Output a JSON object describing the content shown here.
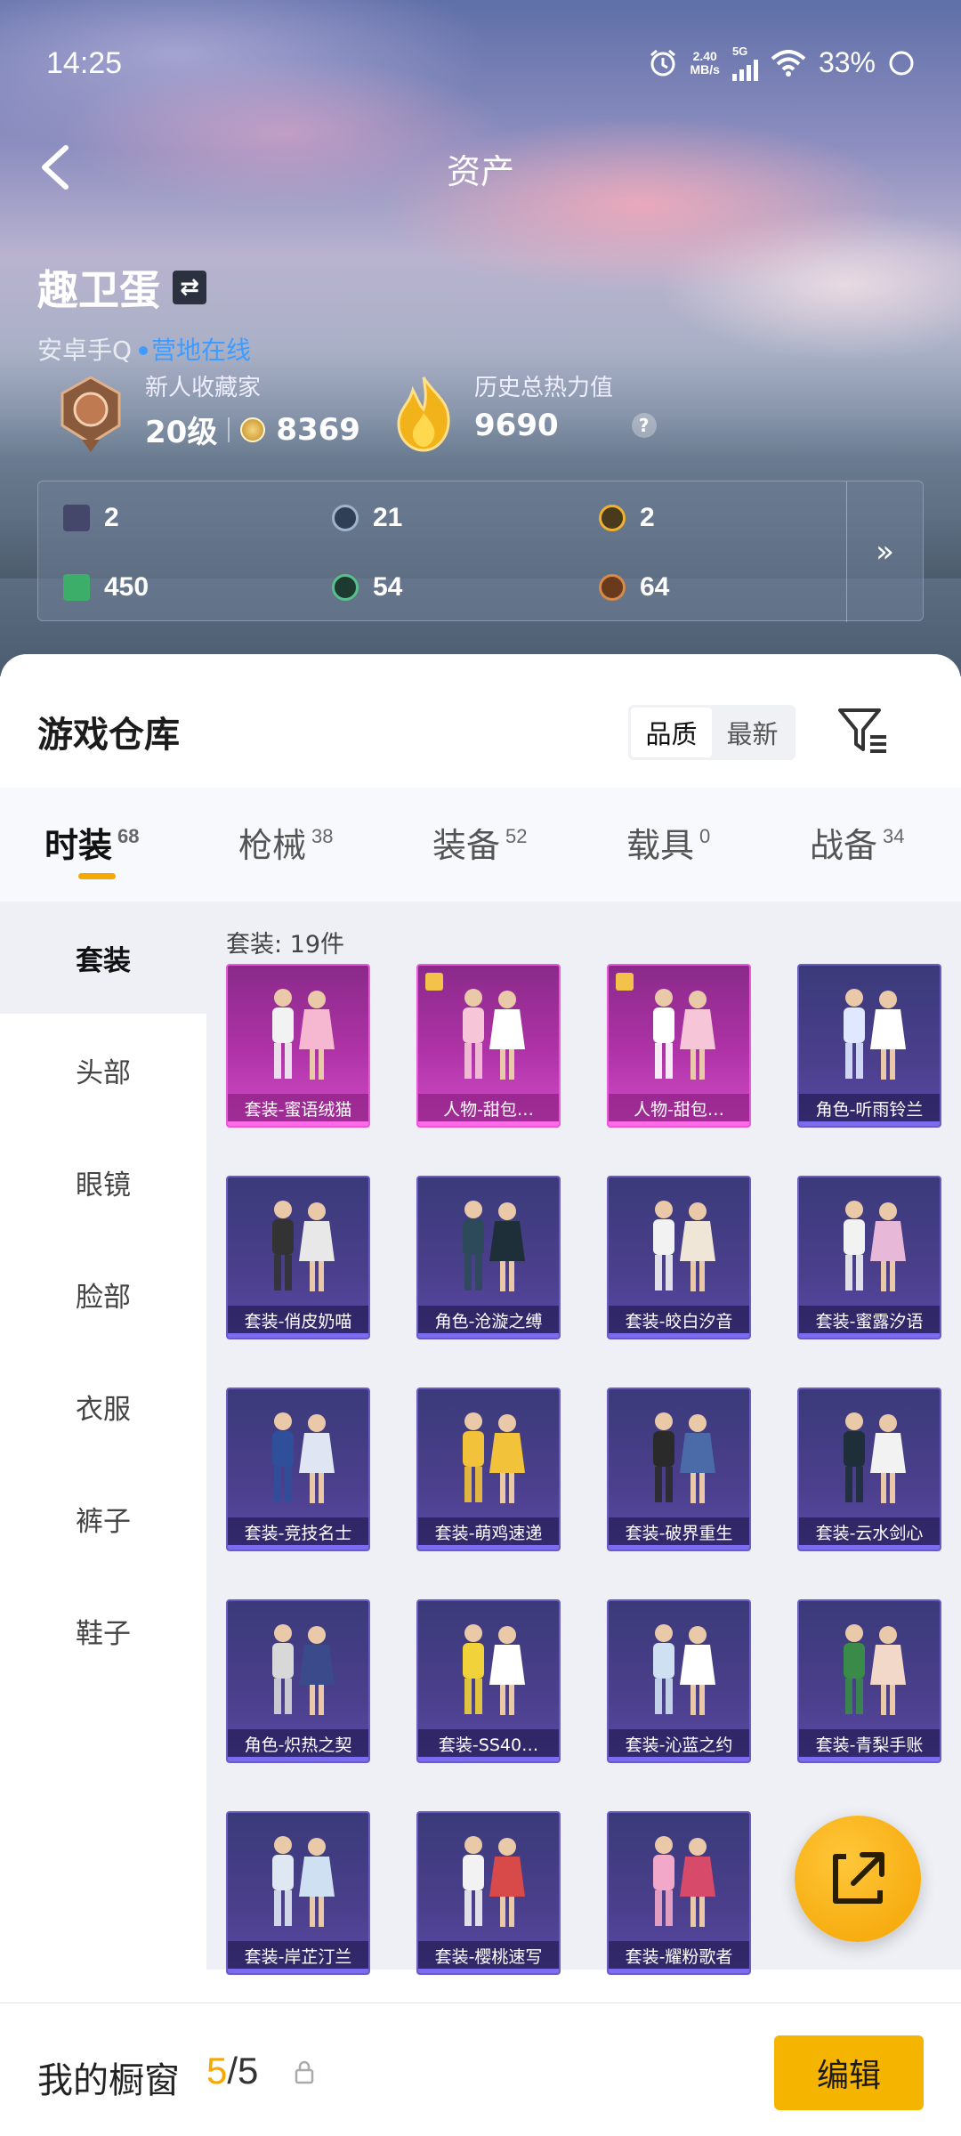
{
  "status": {
    "time": "14:25",
    "speed_top": "2.40",
    "speed_unit": "MB/s",
    "network": "5G",
    "battery": "33%"
  },
  "header": {
    "title": "资产"
  },
  "user": {
    "name": "趣卫蛋",
    "platform": "安卓手Q",
    "status": "营地在线"
  },
  "collector": {
    "label": "新人收藏家",
    "level": "20级",
    "points": "8369"
  },
  "heat": {
    "label": "历史总热力值",
    "value": "9690"
  },
  "resources": [
    "2",
    "21",
    "2",
    "450",
    "54",
    "64"
  ],
  "warehouse": {
    "title": "游戏仓库",
    "sort_options": [
      "品质",
      "最新"
    ],
    "sort_selected": "品质"
  },
  "tabs": [
    {
      "label": "时装",
      "count": "68"
    },
    {
      "label": "枪械",
      "count": "38"
    },
    {
      "label": "装备",
      "count": "52"
    },
    {
      "label": "载具",
      "count": "0"
    },
    {
      "label": "战备",
      "count": "34"
    }
  ],
  "sidebar": [
    "套装",
    "头部",
    "眼镜",
    "脸部",
    "衣服",
    "裤子",
    "鞋子"
  ],
  "grid": {
    "count_label": "套装: 19件",
    "items": [
      {
        "name": "套装-蜜语绒猫",
        "rarity": "pink"
      },
      {
        "name": "人物-甜包…",
        "rarity": "pink"
      },
      {
        "name": "人物-甜包…",
        "rarity": "pink"
      },
      {
        "name": "角色-听雨铃兰",
        "rarity": "purple"
      },
      {
        "name": "套装-俏皮奶喵",
        "rarity": "purple"
      },
      {
        "name": "角色-沧漩之缚",
        "rarity": "purple"
      },
      {
        "name": "套装-皎白汐音",
        "rarity": "purple"
      },
      {
        "name": "套装-蜜露汐语",
        "rarity": "purple"
      },
      {
        "name": "套装-竞技名士",
        "rarity": "purple"
      },
      {
        "name": "套装-萌鸡速递",
        "rarity": "purple"
      },
      {
        "name": "套装-破界重生",
        "rarity": "purple"
      },
      {
        "name": "套装-云水剑心",
        "rarity": "purple"
      },
      {
        "name": "角色-炽热之契",
        "rarity": "purple"
      },
      {
        "name": "套装-SS40…",
        "rarity": "purple"
      },
      {
        "name": "套装-沁蓝之约",
        "rarity": "purple"
      },
      {
        "name": "套装-青梨手账",
        "rarity": "purple"
      },
      {
        "name": "套装-岸芷汀兰",
        "rarity": "purple"
      },
      {
        "name": "套装-樱桃速写",
        "rarity": "purple"
      },
      {
        "name": "套装-耀粉歌者",
        "rarity": "purple"
      }
    ]
  },
  "showcase": {
    "label": "我的橱窗",
    "current": "5",
    "total": "/5",
    "edit_label": "编辑"
  },
  "colors": {
    "accent": "#f5b400",
    "online": "#3e9bff"
  }
}
